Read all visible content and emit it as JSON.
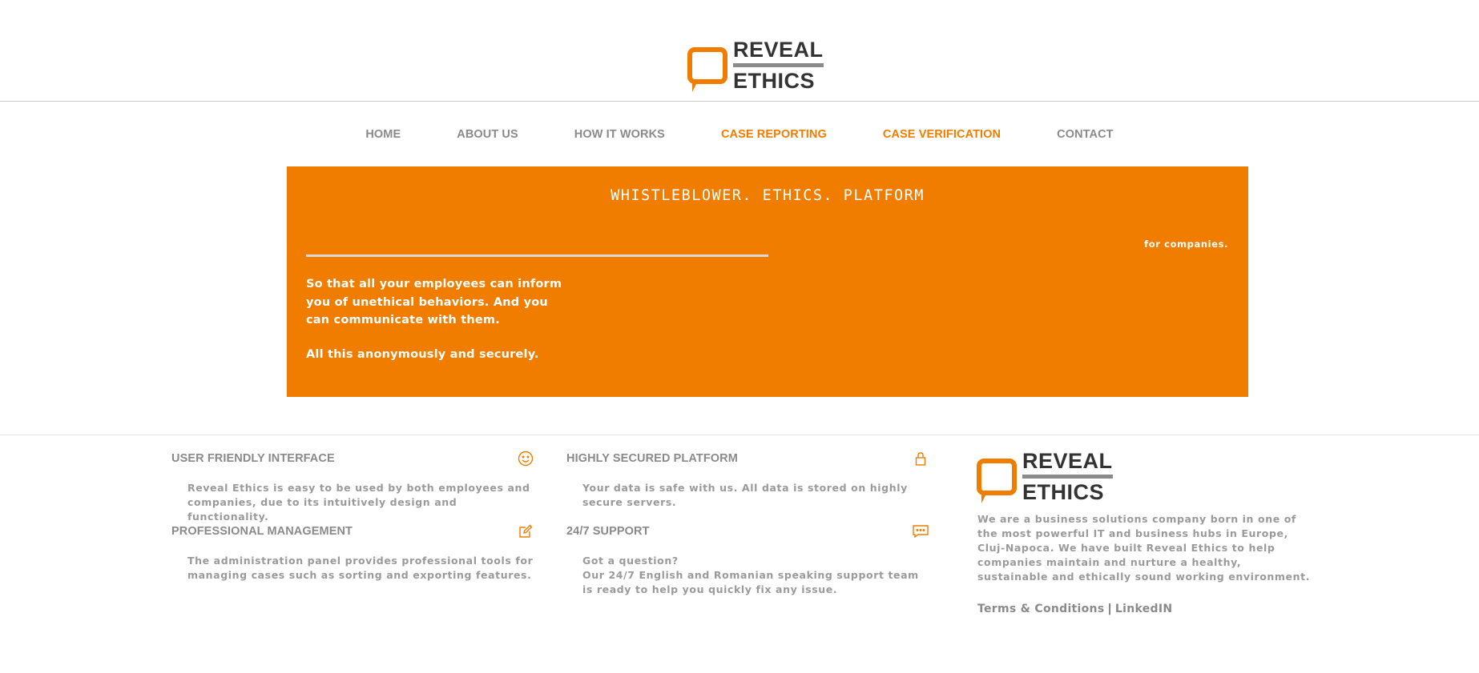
{
  "brand": {
    "name_line1": "REVEAL",
    "name_line2": "ETHICS",
    "accent_color": "#f07d00",
    "logo_icon": "speech-bubble-icon"
  },
  "nav": {
    "items": [
      {
        "label": "HOME",
        "active": false
      },
      {
        "label": "ABOUT US",
        "active": false
      },
      {
        "label": "HOW IT WORKS",
        "active": false
      },
      {
        "label": "CASE REPORTING",
        "active": true
      },
      {
        "label": "CASE VERIFICATION",
        "active": true
      },
      {
        "label": "CONTACT",
        "active": false
      }
    ]
  },
  "hero": {
    "title": "WHISTLEBLOWER. ETHICS. PLATFORM",
    "subtitle": "for companies.",
    "paragraph1": "So that all your employees can inform you of unethical behaviors. And you can communicate with them.",
    "paragraph2": "All this anonymously and securely."
  },
  "features": [
    {
      "title": "USER FRIENDLY INTERFACE",
      "icon": "smiley-icon",
      "description": "Reveal Ethics is easy to be used by both employees and companies, due to its intuitively design and functionality."
    },
    {
      "title": "HIGHLY SECURED PLATFORM",
      "icon": "lock-icon",
      "description": "Your data is safe with us. All data is stored on highly secure servers."
    },
    {
      "title": "PROFESSIONAL MANAGEMENT",
      "icon": "edit-icon",
      "description": "The administration panel provides professional tools for managing cases such as sorting and exporting features."
    },
    {
      "title": "24/7 SUPPORT",
      "icon": "chat-icon",
      "description_line1": "Got a question?",
      "description_line2": "Our 24/7 English and Romanian speaking support team is ready to help you quickly fix any issue."
    }
  ],
  "footer": {
    "about": "We are a business solutions company born in one of the most powerful IT and business hubs in Europe, Cluj-Napoca. We have built Reveal Ethics to help companies maintain and nurture a healthy, sustainable and ethically sound working environment.",
    "terms_label": "Terms & Conditions",
    "separator": "|",
    "linkedin_label": "LinkedIN"
  }
}
